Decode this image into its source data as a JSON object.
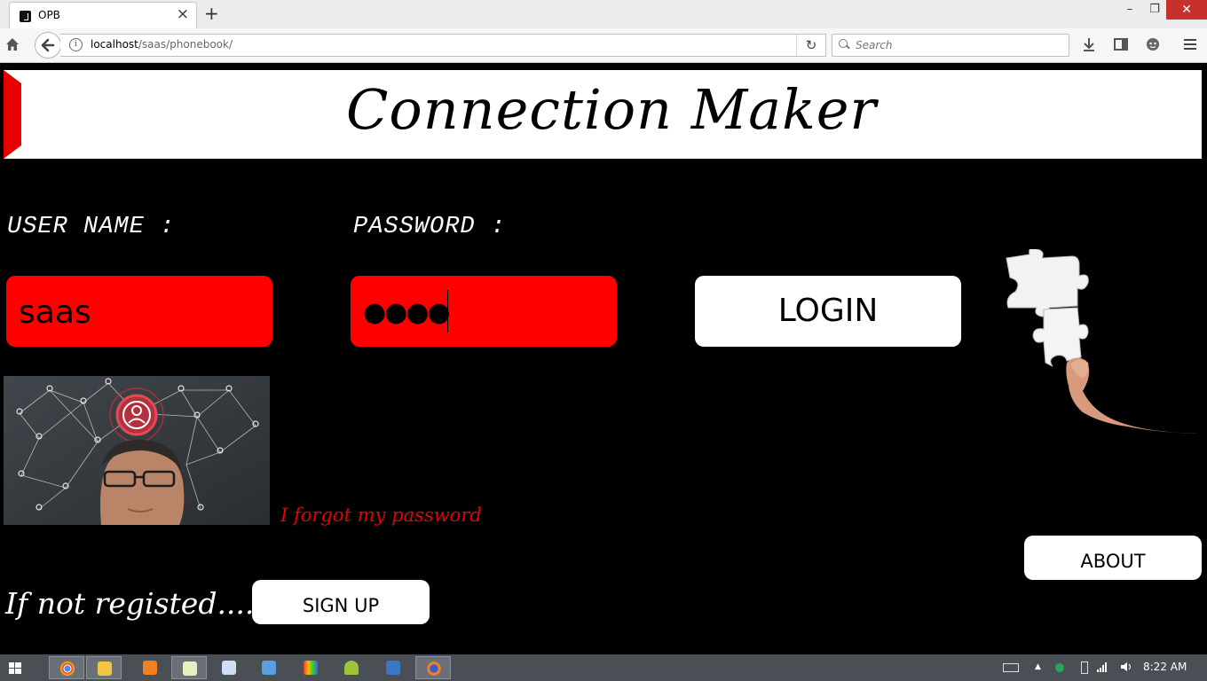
{
  "browser": {
    "tab_title": "OPB",
    "url_host": "localhost",
    "url_path": "/saas/phonebook/",
    "search_placeholder": "Search",
    "window_controls": {
      "minimize": "–",
      "maximize": "❐",
      "close": "✕"
    }
  },
  "header": {
    "title": "Connection Maker",
    "accent_color": "#e80000"
  },
  "login_form": {
    "username_label": "USER NAME  :",
    "password_label": "PASSWORD  :",
    "username_value": "saas",
    "password_masked": "●●●●",
    "login_label": "LOGIN",
    "input_color": "#ff0000"
  },
  "links": {
    "forgot_password": "I forgot my password",
    "not_registered": "If not registed...."
  },
  "buttons": {
    "about": "ABOUT",
    "signup": "SIGN UP"
  },
  "taskbar": {
    "time": "8:22 AM",
    "apps": [
      "start-icon",
      "chrome-icon",
      "file-explorer-icon",
      "xampp-icon",
      "notepad-icon",
      "document-icon",
      "computer-icon",
      "color-app-icon",
      "android-icon",
      "virtualbox-icon",
      "firefox-icon"
    ]
  }
}
